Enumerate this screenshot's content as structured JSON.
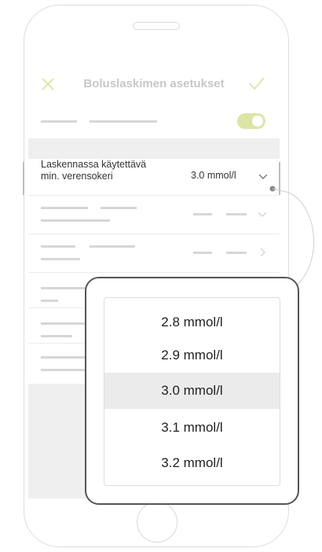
{
  "header": {
    "title": "Boluslaskimen asetukset"
  },
  "setting": {
    "label_line1": "Laskennassa käytettävä",
    "label_line2": "min. verensokeri",
    "value": "3.0 mmol/l"
  },
  "picker": {
    "options": [
      "2.8 mmol/l",
      "2.9 mmol/l",
      "3.0 mmol/l",
      "3.1 mmol/l",
      "3.2 mmol/l"
    ],
    "selected": "3.0 mmol/l"
  },
  "colors": {
    "accent": "#dce5a6",
    "title": "#c7c7c7"
  }
}
